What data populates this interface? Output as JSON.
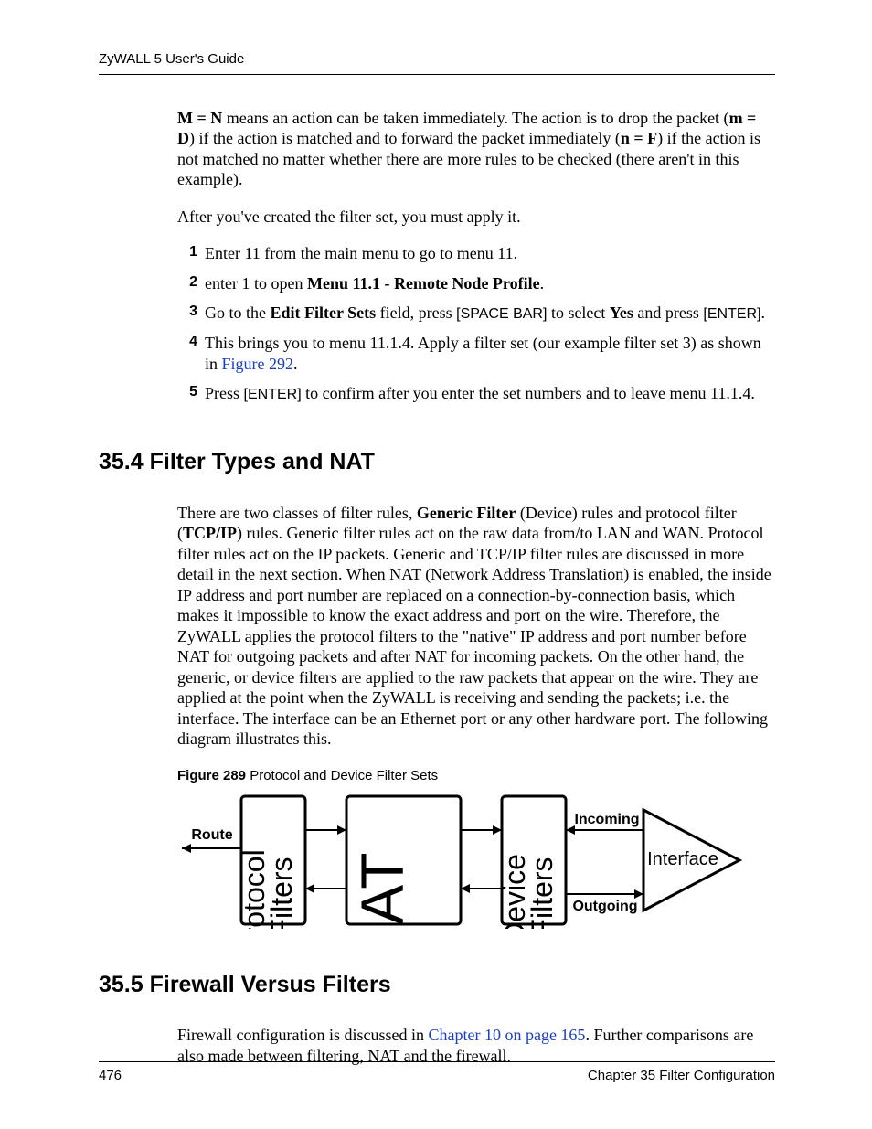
{
  "header": {
    "guide_title": "ZyWALL 5 User's Guide"
  },
  "intro": {
    "para1_parts": {
      "a": "M = N",
      "b": " means an action can be taken immediately. The action is to drop the packet (",
      "c": "m = D",
      "d": ") if the action is matched and to forward the packet immediately (",
      "e": "n = F",
      "f": ") if the action is not matched no matter whether there are more rules to be checked (there aren't in this example)."
    },
    "para2": "After you've created the filter set, you must apply it."
  },
  "steps": [
    {
      "num": "1",
      "text": "Enter 11 from the main menu to go to menu 11."
    },
    {
      "num": "2",
      "parts": {
        "a": "enter 1 to open ",
        "b": "Menu 11.1 - Remote Node Profile",
        "c": "."
      }
    },
    {
      "num": "3",
      "parts": {
        "a": "Go to the ",
        "b": "Edit Filter Sets",
        "c": " field, press ",
        "d": "[SPACE BAR]",
        "e": " to select ",
        "f": "Yes",
        "g": " and press ",
        "h": "[ENTER]",
        "i": "."
      }
    },
    {
      "num": "4",
      "parts": {
        "a": "This brings you to menu 11.1.4. Apply a filter set (our example filter set 3) as shown in ",
        "link": "Figure 292",
        "b": "."
      }
    },
    {
      "num": "5",
      "parts": {
        "a": "Press ",
        "b": "[ENTER]",
        "c": " to confirm after you enter the set numbers and to leave menu 11.1.4."
      }
    }
  ],
  "section_354": {
    "title": "35.4  Filter Types and NAT",
    "body_parts": {
      "a": "There are two classes of filter rules, ",
      "b": "Generic Filter",
      "c": " (Device) rules and protocol filter (",
      "d": "TCP/IP",
      "e": ") rules. Generic filter rules act on the raw data from/to LAN and WAN. Protocol filter rules act on the IP packets. Generic and TCP/IP filter rules are discussed in more detail in the next section. When NAT  (Network Address Translation) is enabled, the inside IP address and port number are replaced on a connection-by-connection basis, which makes it impossible to know the exact address and port on the wire. Therefore, the ZyWALL applies the protocol filters to the \"native\" IP address and port number before NAT for outgoing packets and after NAT for incoming packets. On the other hand, the generic, or device filters are applied to the raw packets that appear on the wire. They are applied at the point when the ZyWALL is receiving and sending the packets; i.e. the interface. The interface can be an Ethernet port or any other hardware port. The following diagram illustrates this."
    }
  },
  "figure": {
    "num": "Figure 289",
    "caption": "   Protocol and Device Filter Sets",
    "labels": {
      "route": "Route",
      "protocol": "Protocol",
      "filters1": "Filters",
      "nat": "NAT",
      "device": "Device",
      "filters2": "Filters",
      "incoming": "Incoming",
      "outgoing": "Outgoing",
      "interface": "Interface"
    }
  },
  "section_355": {
    "title": "35.5  Firewall Versus Filters",
    "body_parts": {
      "a": "Firewall configuration is discussed in ",
      "link": "Chapter 10 on page 165",
      "b": ". Further comparisons are also made between filtering, NAT and the firewall."
    }
  },
  "footer": {
    "page_number": "476",
    "chapter": "Chapter 35 Filter Configuration"
  }
}
